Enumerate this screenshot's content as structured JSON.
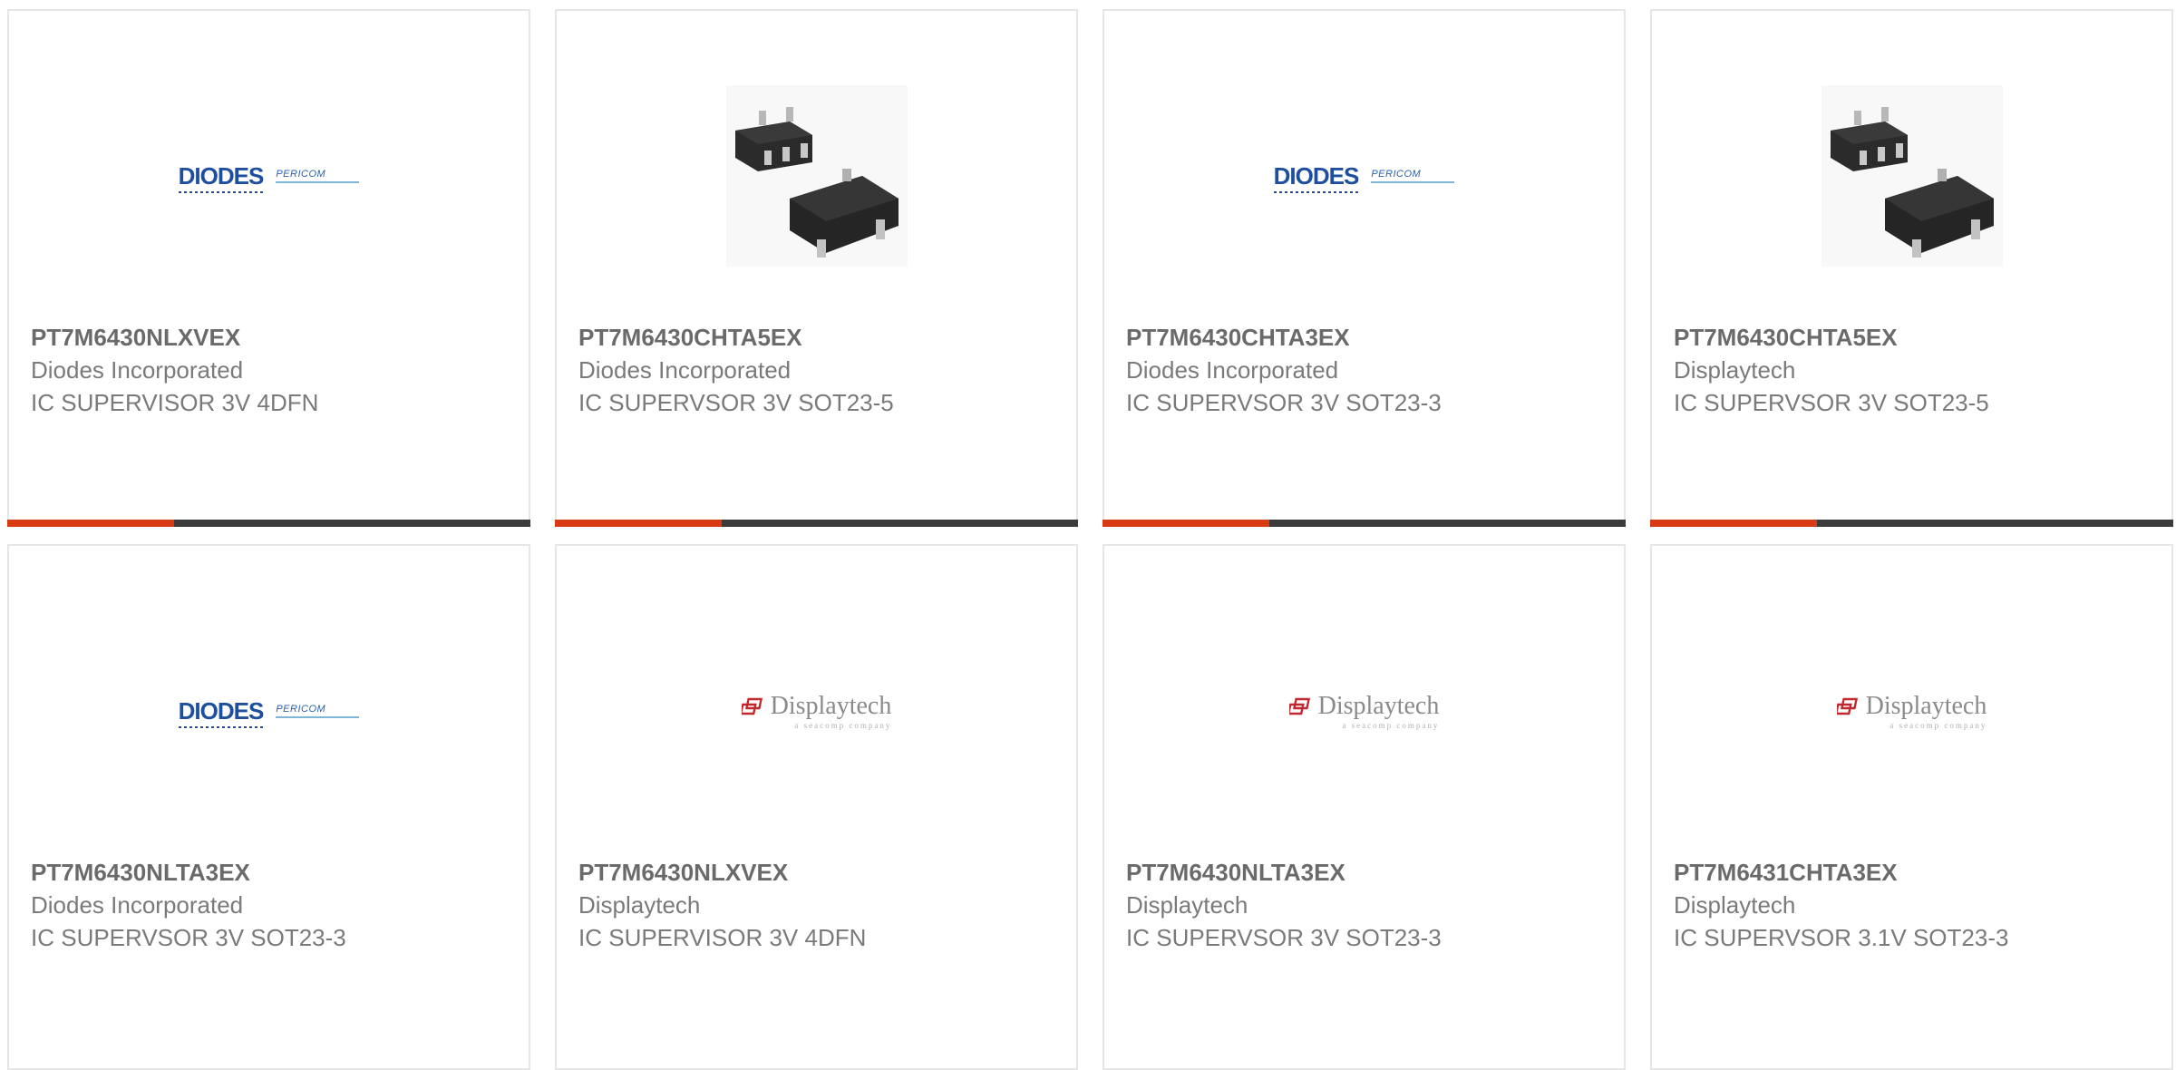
{
  "products": [
    {
      "part": "PT7M6430NLXVEX",
      "manufacturer": "Diodes Incorporated",
      "description": "IC SUPERVISOR 3V 4DFN",
      "image": "diodes-pericom-logo"
    },
    {
      "part": "PT7M6430CHTA5EX",
      "manufacturer": "Diodes Incorporated",
      "description": "IC SUPERVSOR 3V SOT23-5",
      "image": "sot23-5-package-photo"
    },
    {
      "part": "PT7M6430CHTA3EX",
      "manufacturer": "Diodes Incorporated",
      "description": "IC SUPERVSOR 3V SOT23-3",
      "image": "diodes-pericom-logo"
    },
    {
      "part": "PT7M6430CHTA5EX",
      "manufacturer": "Displaytech",
      "description": "IC SUPERVSOR 3V SOT23-5",
      "image": "sot23-5-package-photo"
    },
    {
      "part": "PT7M6430NLTA3EX",
      "manufacturer": "Diodes Incorporated",
      "description": "IC SUPERVSOR 3V SOT23-3",
      "image": "diodes-pericom-logo"
    },
    {
      "part": "PT7M6430NLXVEX",
      "manufacturer": "Displaytech",
      "description": "IC SUPERVISOR 3V 4DFN",
      "image": "displaytech-logo"
    },
    {
      "part": "PT7M6430NLTA3EX",
      "manufacturer": "Displaytech",
      "description": "IC SUPERVSOR 3V SOT23-3",
      "image": "displaytech-logo"
    },
    {
      "part": "PT7M6431CHTA3EX",
      "manufacturer": "Displaytech",
      "description": "IC SUPERVSOR 3.1V SOT23-3",
      "image": "displaytech-logo"
    }
  ],
  "logos": {
    "diodes": "DIODES",
    "pericom": "PERICOM",
    "displaytech": "Displaytech",
    "displaytech_tagline": "a seacomp company"
  },
  "colors": {
    "accent": "#d83a14",
    "bar": "#3b3b3b",
    "diodes_blue": "#1d4f9e",
    "displaytech_red": "#c0282d"
  }
}
